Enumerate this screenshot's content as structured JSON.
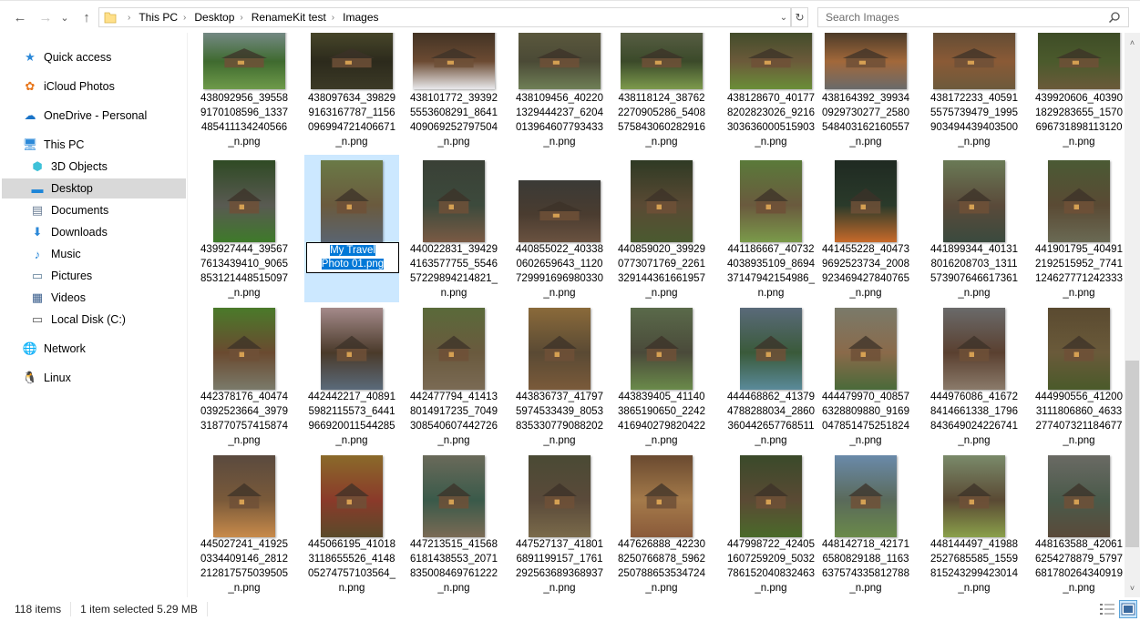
{
  "toolbar": {
    "back_icon": "←",
    "forward_icon": "→",
    "recent_icon": "⌄",
    "up_icon": "↑",
    "breadcrumb": [
      "This PC",
      "Desktop",
      "RenameKit test",
      "Images"
    ],
    "dropdown_icon": "⌄",
    "refresh_icon": "↻",
    "search_placeholder": "Search Images",
    "search_icon": "⚲"
  },
  "sidebar": {
    "items": [
      {
        "label": "Quick access",
        "icon": "star-icon",
        "glyph": "★",
        "color": "#2b88d8",
        "indent": 0
      },
      {
        "label": "iCloud Photos",
        "icon": "icloud-photos-icon",
        "glyph": "✿",
        "color": "#e8761b",
        "indent": 0
      },
      {
        "label": "OneDrive - Personal",
        "icon": "onedrive-icon",
        "glyph": "☁",
        "color": "#1a73c7",
        "indent": 0
      },
      {
        "label": "This PC",
        "icon": "computer-icon",
        "glyph": "🖥",
        "color": "#2b88d8",
        "indent": 0
      },
      {
        "label": "3D Objects",
        "icon": "3d-objects-icon",
        "glyph": "⬢",
        "color": "#3ec1d8",
        "indent": 1
      },
      {
        "label": "Desktop",
        "icon": "desktop-icon",
        "glyph": "▬",
        "color": "#1e86d8",
        "indent": 1,
        "selected": true
      },
      {
        "label": "Documents",
        "icon": "documents-icon",
        "glyph": "▤",
        "color": "#6a7d95",
        "indent": 1
      },
      {
        "label": "Downloads",
        "icon": "downloads-icon",
        "glyph": "⬇",
        "color": "#2b88d8",
        "indent": 1
      },
      {
        "label": "Music",
        "icon": "music-icon",
        "glyph": "♪",
        "color": "#2b88d8",
        "indent": 1
      },
      {
        "label": "Pictures",
        "icon": "pictures-icon",
        "glyph": "▭",
        "color": "#5a7b95",
        "indent": 1
      },
      {
        "label": "Videos",
        "icon": "videos-icon",
        "glyph": "▦",
        "color": "#3a5e8c",
        "indent": 1
      },
      {
        "label": "Local Disk (C:)",
        "icon": "local-disk-icon",
        "glyph": "▭",
        "color": "#555555",
        "indent": 1
      },
      {
        "label": "Network",
        "icon": "network-icon",
        "glyph": "🌐",
        "color": "#2b88d8",
        "indent": 0
      },
      {
        "label": "Linux",
        "icon": "linux-icon",
        "glyph": "🐧",
        "color": "#222222",
        "indent": 0
      }
    ]
  },
  "files": [
    {
      "name": "438092956_395589170108596_1337485411134240566_n.png",
      "lines": [
        "438092956_39558",
        "9170108596_1337",
        "485411134240566",
        "_n.png"
      ],
      "colors": [
        "#7e8f94",
        "#3f6a2f",
        "#6e9a4a"
      ],
      "orient": "landscape"
    },
    {
      "name": "438097634_398299163167787_1156096994721406671_n.png",
      "lines": [
        "438097634_39829",
        "9163167787_1156",
        "096994721406671",
        "_n.png"
      ],
      "colors": [
        "#4c4b2c",
        "#2c2a1c",
        "#3c3a26"
      ],
      "orient": "landscape"
    },
    {
      "name": "438101772_393925553608291_8641409069252797504_n.png",
      "lines": [
        "438101772_39392",
        "5553608291_8641",
        "409069252797504",
        "_n.png"
      ],
      "colors": [
        "#3b2f22",
        "#6b4a32",
        "#e9e9ec"
      ],
      "orient": "landscape"
    },
    {
      "name": "438109456_402201329444237_6204013964607793433_n.png",
      "lines": [
        "438109456_40220",
        "1329444237_6204",
        "013964607793433",
        "_n.png"
      ],
      "colors": [
        "#5d5a3e",
        "#4b4a36",
        "#6f7f56"
      ],
      "orient": "landscape"
    },
    {
      "name": "438118124_387622270905286_5408575843060282916_n.png",
      "lines": [
        "438118124_38762",
        "2270905286_5408",
        "575843060282916",
        "_n.png"
      ],
      "colors": [
        "#5c6047",
        "#3b4a2a",
        "#7d9a4c"
      ],
      "orient": "landscape"
    },
    {
      "name": "438128670_401778202823026_9216303636000515903_n.png",
      "lines": [
        "438128670_40177",
        "8202823026_9216",
        "303636000515903",
        "_n.png"
      ],
      "colors": [
        "#3b4a28",
        "#6b5a3a",
        "#6a8e38"
      ],
      "orient": "landscape"
    },
    {
      "name": "438164392_399340929730277_2580548403162160557_n.png",
      "lines": [
        "438164392_39934",
        "0929730277_2580",
        "548403162160557",
        "_n.png"
      ],
      "colors": [
        "#3c3326",
        "#a2683a",
        "#6a6a6a"
      ],
      "orient": "landscape"
    },
    {
      "name": "438172233_405915575739479_1995903494439403500_n.png",
      "lines": [
        "438172233_40591",
        "5575739479_1995",
        "903494439403500",
        "_n.png"
      ],
      "colors": [
        "#5c4a34",
        "#8a5a36",
        "#6d5a3c"
      ],
      "orient": "landscape"
    },
    {
      "name": "439920606_403901829283655_1570696731898113120_n.png",
      "lines": [
        "439920606_40390",
        "1829283655_1570",
        "696731898113120",
        "_n.png"
      ],
      "colors": [
        "#3c4a26",
        "#4b5a2c",
        "#6a5a3a"
      ],
      "orient": "landscape"
    },
    {
      "name": "439927444_395677613439410_9065853121448515097_n.png",
      "lines": [
        "439927444_39567",
        "7613439410_9065",
        "853121448515097",
        "_n.png"
      ],
      "colors": [
        "#2f4a24",
        "#595a52",
        "#3e7a2a"
      ],
      "orient": "portrait"
    },
    {
      "name": "My Travel Photo 01.png",
      "lines": [
        "My Travel",
        "Photo 01.png"
      ],
      "colors": [
        "#6a7a46",
        "#6a5a3e",
        "#5a6470"
      ],
      "orient": "portrait",
      "selected": true,
      "renaming": true
    },
    {
      "name": "440022831_394294163577755_554657229894214821_n.png",
      "lines": [
        "440022831_39429",
        "4163577755_5546",
        "57229894214821_",
        "n.png"
      ],
      "colors": [
        "#3a4036",
        "#3c4a3c",
        "#7a5a44"
      ],
      "orient": "portrait"
    },
    {
      "name": "440855022_403380602659643_1120729991696980330_n.png",
      "lines": [
        "440855022_40338",
        "0602659643_1120",
        "729991696980330",
        "_n.png"
      ],
      "colors": [
        "#3a3a36",
        "#4a3c30",
        "#6a5240"
      ],
      "orient": "landscape"
    },
    {
      "name": "440859020_399290773071769_2261329144361661957_n.png",
      "lines": [
        "440859020_39929",
        "0773071769_2261",
        "329144361661957",
        "_n.png"
      ],
      "colors": [
        "#2f3a24",
        "#5a4a34",
        "#4a5a30"
      ],
      "orient": "portrait"
    },
    {
      "name": "441186667_407324038935109_869437147942154986_n.png",
      "lines": [
        "441186667_40732",
        "4038935109_8694",
        "37147942154986_",
        "n.png"
      ],
      "colors": [
        "#5a7a3a",
        "#6a5a3e",
        "#7a9a4a"
      ],
      "orient": "portrait"
    },
    {
      "name": "441455228_404739692523734_2008923469427840765_n.png",
      "lines": [
        "441455228_40473",
        "9692523734_2008",
        "923469427840765",
        "_n.png"
      ],
      "colors": [
        "#1f2a22",
        "#2a3a2a",
        "#c86a2a"
      ],
      "orient": "portrait"
    },
    {
      "name": "441899344_401318016208703_1311573907646617361_n.png",
      "lines": [
        "441899344_40131",
        "8016208703_1311",
        "573907646617361",
        "_n.png"
      ],
      "colors": [
        "#6a7a56",
        "#5a4a3a",
        "#3a4a3e"
      ],
      "orient": "portrait"
    },
    {
      "name": "441901795_404912192515952_7741124627771242333_n.png",
      "lines": [
        "441901795_40491",
        "2192515952_7741",
        "124627771242333",
        "_n.png"
      ],
      "colors": [
        "#4a5a34",
        "#5a4a34",
        "#6a6a54"
      ],
      "orient": "portrait"
    },
    {
      "name": "442378176_404740392523664_3979318770757415874_n.png",
      "lines": [
        "442378176_40474",
        "0392523664_3979",
        "318770757415874",
        "_n.png"
      ],
      "colors": [
        "#4a7a2a",
        "#6a4a30",
        "#7a7a6a"
      ],
      "orient": "portrait"
    },
    {
      "name": "442442217_408915982115573_6441966920011544285_n.png",
      "lines": [
        "442442217_40891",
        "5982115573_6441",
        "966920011544285",
        "_n.png"
      ],
      "colors": [
        "#a48a8a",
        "#4a3a2a",
        "#5a6a7a"
      ],
      "orient": "portrait"
    },
    {
      "name": "442477794_414138014917235_7049308540607442726_n.png",
      "lines": [
        "442477794_41413",
        "8014917235_7049",
        "308540607442726",
        "_n.png"
      ],
      "colors": [
        "#5a6a3a",
        "#6a5a3e",
        "#7a6a54"
      ],
      "orient": "portrait"
    },
    {
      "name": "443836737_417975974533439_8053835330779088202_n.png",
      "lines": [
        "443836737_41797",
        "5974533439_8053",
        "835330779088202",
        "_n.png"
      ],
      "colors": [
        "#8a6a3a",
        "#5a4a34",
        "#7a5a3a"
      ],
      "orient": "portrait"
    },
    {
      "name": "443839405_411403865190650_2242416940279820422_n.png",
      "lines": [
        "443839405_41140",
        "3865190650_2242",
        "416940279820422",
        "_n.png"
      ],
      "colors": [
        "#5a6a4a",
        "#4a4a3a",
        "#6a8a4a"
      ],
      "orient": "portrait"
    },
    {
      "name": "444468862_413794788288034_2860360442657768511_n.png",
      "lines": [
        "444468862_41379",
        "4788288034_2860",
        "360442657768511",
        "_n.png"
      ],
      "colors": [
        "#5a6a7a",
        "#3a5a3a",
        "#5a8a9a"
      ],
      "orient": "portrait"
    },
    {
      "name": "444479970_408576328809880_9169047851475251824_n.png",
      "lines": [
        "444479970_40857",
        "6328809880_9169",
        "047851475251824",
        "_n.png"
      ],
      "colors": [
        "#7a7a6a",
        "#8a6a4a",
        "#4a6a3a"
      ],
      "orient": "portrait"
    },
    {
      "name": "444976086_416728414661338_1796843649024226741_n.png",
      "lines": [
        "444976086_41672",
        "8414661338_1796",
        "843649024226741",
        "_n.png"
      ],
      "colors": [
        "#6a6a6a",
        "#5a4030",
        "#8a7a6a"
      ],
      "orient": "portrait"
    },
    {
      "name": "444990556_412003111806860_4633277407321184677_n.png",
      "lines": [
        "444990556_41200",
        "3111806860_4633",
        "277407321184677",
        "_n.png"
      ],
      "colors": [
        "#5a4a30",
        "#6a5a3a",
        "#4a5a2a"
      ],
      "orient": "portrait"
    },
    {
      "name": "445027241_419250334409146_2812212817575039505_n.png",
      "lines": [
        "445027241_41925",
        "0334409146_2812",
        "212817575039505",
        "_n.png"
      ],
      "colors": [
        "#5a4a3e",
        "#7a5a3a",
        "#c88a4a"
      ],
      "orient": "portrait"
    },
    {
      "name": "445066195_410183118655526_414805274757103564_n.png",
      "lines": [
        "445066195_41018",
        "3118655526_4148",
        "05274757103564_",
        "n.png"
      ],
      "colors": [
        "#8a6a2a",
        "#8a3a2a",
        "#5a4a2a"
      ],
      "orient": "portrait"
    },
    {
      "name": "447213515_415686181438553_2071835008469761222_n.png",
      "lines": [
        "447213515_41568",
        "6181438553_2071",
        "835008469761222",
        "_n.png"
      ],
      "colors": [
        "#6a6a5a",
        "#3a5a4a",
        "#7a6a54"
      ],
      "orient": "portrait"
    },
    {
      "name": "447527137_418016891199157_1761292563689368937_n.png",
      "lines": [
        "447527137_41801",
        "6891199157_1761",
        "292563689368937",
        "_n.png"
      ],
      "colors": [
        "#4a4a34",
        "#5a4a3a",
        "#7a6a4a"
      ],
      "orient": "portrait"
    },
    {
      "name": "447626888_422308250766878_5962250788653534724_n.png",
      "lines": [
        "447626888_42230",
        "8250766878_5962",
        "250788653534724",
        "_n.png"
      ],
      "colors": [
        "#6a4a30",
        "#a47a4a",
        "#8a5a3a"
      ],
      "orient": "portrait"
    },
    {
      "name": "447998722_424051607259209_5032786152040832463_n.png",
      "lines": [
        "447998722_42405",
        "1607259209_5032",
        "786152040832463",
        "_n.png"
      ],
      "colors": [
        "#3a4a2a",
        "#5a4a34",
        "#4a6a2a"
      ],
      "orient": "portrait"
    },
    {
      "name": "448142718_421716580829188_1163637574335812788_n.png",
      "lines": [
        "448142718_42171",
        "6580829188_1163",
        "637574335812788",
        "_n.png"
      ],
      "colors": [
        "#6a8aaa",
        "#5a6a5a",
        "#6a8a4a"
      ],
      "orient": "portrait"
    },
    {
      "name": "448144497_419882527685585_1559815243299423014_n.png",
      "lines": [
        "448144497_41988",
        "2527685585_1559",
        "815243299423014",
        "_n.png"
      ],
      "colors": [
        "#7a8a6a",
        "#5a4a34",
        "#8aa04a"
      ],
      "orient": "portrait"
    },
    {
      "name": "448163588_420616254278879_5797681780264340919_n.png",
      "lines": [
        "448163588_42061",
        "6254278879_5797",
        "681780264340919",
        "_n.png"
      ],
      "colors": [
        "#6a6a64",
        "#4a5a4a",
        "#5a4a3a"
      ],
      "orient": "portrait"
    }
  ],
  "scrollbar": {
    "up_icon": "˄",
    "down_icon": "˅"
  },
  "status": {
    "item_count": "118 items",
    "selection": "1 item selected  5.29 MB"
  },
  "view_buttons": [
    {
      "name": "details-view-button",
      "glyph": "☷",
      "active": false
    },
    {
      "name": "large-icons-view-button",
      "glyph": "▣",
      "active": true
    }
  ]
}
